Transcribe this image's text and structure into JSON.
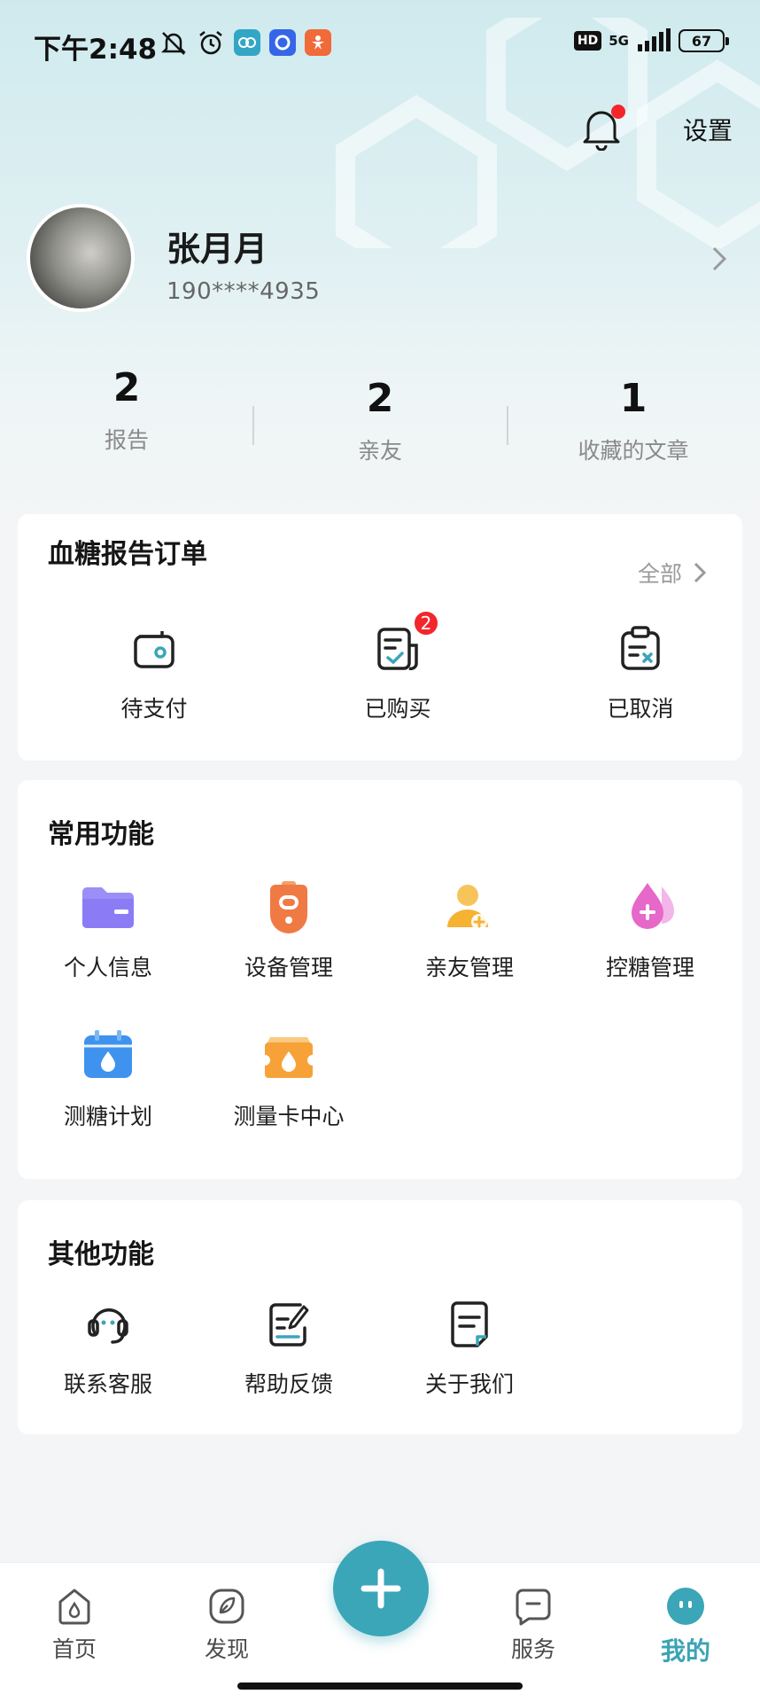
{
  "status_bar": {
    "time": "下午2:48",
    "hd": "HD",
    "network": "5G",
    "battery": "67"
  },
  "header": {
    "settings_label": "设置"
  },
  "profile": {
    "name": "张月月",
    "phone": "190****4935"
  },
  "stats": [
    {
      "value": "2",
      "label": "报告"
    },
    {
      "value": "2",
      "label": "亲友"
    },
    {
      "value": "1",
      "label": "收藏的文章"
    }
  ],
  "orders": {
    "title": "血糖报告订单",
    "more_label": "全部",
    "items": [
      {
        "label": "待支付",
        "icon": "wallet-icon"
      },
      {
        "label": "已购买",
        "icon": "purchased-document-icon",
        "badge": "2"
      },
      {
        "label": "已取消",
        "icon": "cancelled-clipboard-icon"
      }
    ]
  },
  "common": {
    "title": "常用功能",
    "items": [
      {
        "label": "个人信息",
        "icon": "folder-icon",
        "color": "#8b7cf6"
      },
      {
        "label": "设备管理",
        "icon": "device-icon",
        "color": "#f07a43"
      },
      {
        "label": "亲友管理",
        "icon": "add-friend-icon",
        "color": "#f5b233"
      },
      {
        "label": "控糖管理",
        "icon": "blood-drop-icon",
        "color": "#e668c9"
      },
      {
        "label": "测糖计划",
        "icon": "calendar-drop-icon",
        "color": "#3f93ee"
      },
      {
        "label": "测量卡中心",
        "icon": "measure-card-icon",
        "color": "#f7a238"
      }
    ]
  },
  "other": {
    "title": "其他功能",
    "items": [
      {
        "label": "联系客服",
        "icon": "customer-service-icon"
      },
      {
        "label": "帮助反馈",
        "icon": "feedback-icon"
      },
      {
        "label": "关于我们",
        "icon": "about-icon"
      }
    ]
  },
  "bottom_nav": {
    "items": [
      {
        "label": "首页",
        "icon": "home-icon"
      },
      {
        "label": "发现",
        "icon": "discover-icon"
      },
      {
        "label": "服务",
        "icon": "service-icon"
      },
      {
        "label": "我的",
        "icon": "my-icon",
        "active": true
      }
    ],
    "fab_icon": "plus-icon"
  },
  "colors": {
    "accent": "#3aa6b8",
    "badge": "#f2262b"
  }
}
